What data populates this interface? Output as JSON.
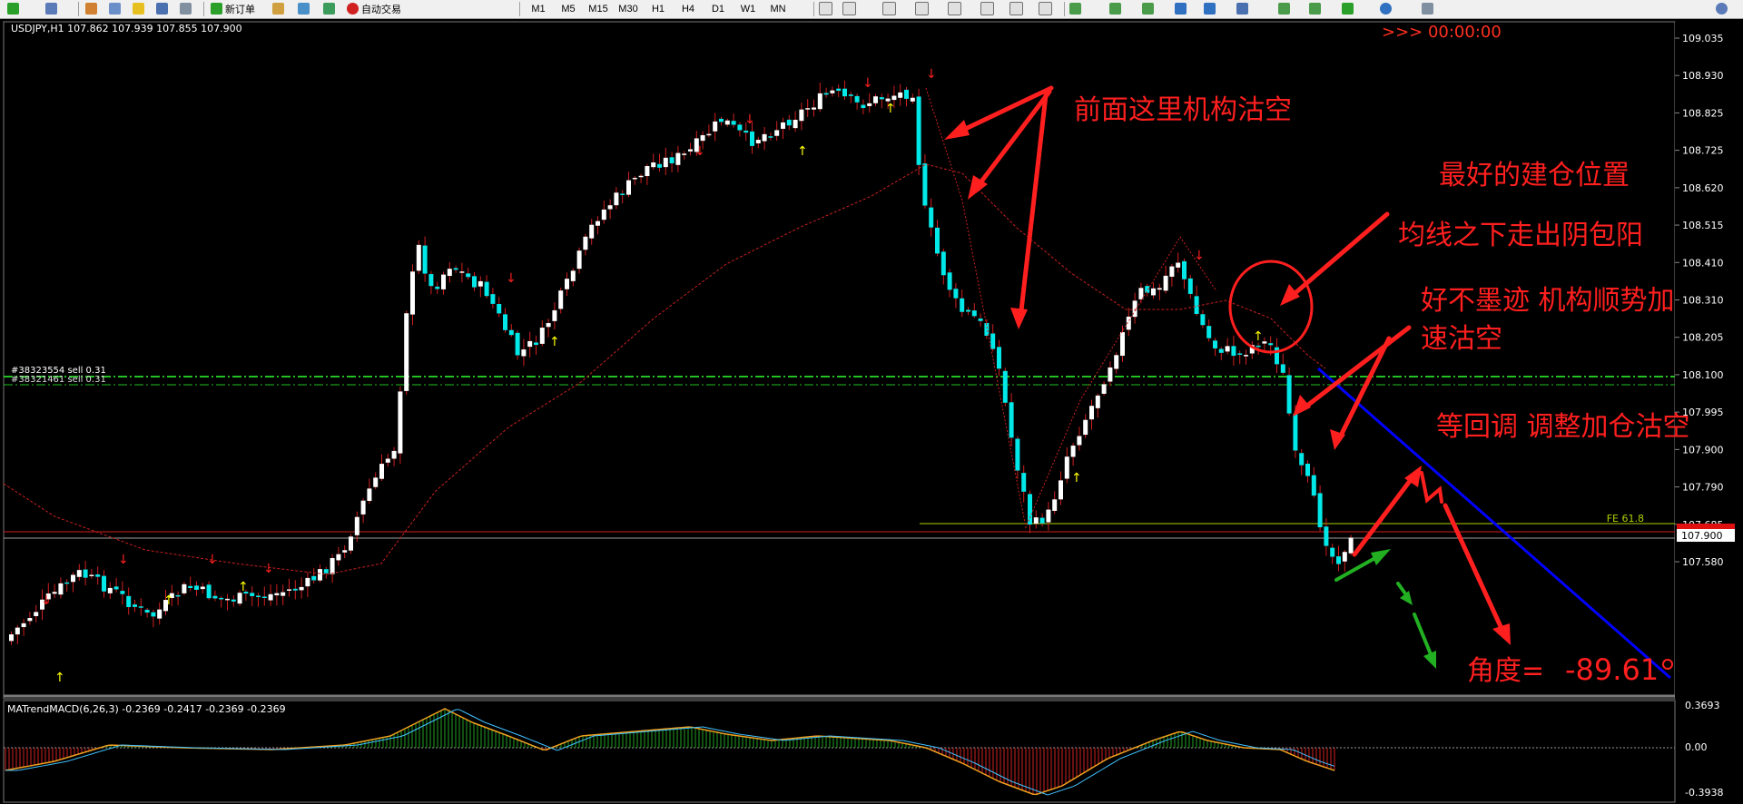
{
  "toolbar": {
    "new_order_label": "新订单",
    "auto_trading_label": "自动交易",
    "timeframes": [
      "M1",
      "M5",
      "M15",
      "M30",
      "H1",
      "H4",
      "D1",
      "W1",
      "MN"
    ]
  },
  "main": {
    "header": "USDJPY,H1  107.862 107.939 107.855 107.900",
    "countdown": ">>> 00:00:00",
    "order_line_1": "#38323554 sell 0.31",
    "order_line_2": "#38321461 sell 0.31",
    "fe_label": "FE 61.8",
    "price_tag": "107.900",
    "y_ticks": [
      "109.035",
      "108.930",
      "108.825",
      "108.725",
      "108.620",
      "108.515",
      "108.410",
      "108.310",
      "108.205",
      "108.100",
      "107.995",
      "107.900",
      "107.790",
      "107.685",
      "107.580"
    ]
  },
  "annotations": {
    "label_1": "前面这里机构沽空",
    "label_2": "最好的建仓位置",
    "label_3": "均线之下走出阴包阳",
    "label_4": "好不墨迹  机构顺势加",
    "label_5": "速沽空",
    "label_6": "等回调 调整加仓沽空",
    "angle_label": "角度=",
    "angle_value": "-89.61"
  },
  "indicator": {
    "header": "MATrendMACD(6,26,3) -0.2369 -0.2417 -0.2369 -0.2369",
    "y_ticks": [
      "0.3693",
      "0.00",
      "-0.3938"
    ]
  },
  "colors": {
    "bull_candle": "#ffffff",
    "bear_candle": "#00e8e8",
    "annotation_red": "#ff1f1f",
    "trend_line": "#0000ff",
    "order_lines": "#22c022",
    "fe_line": "#b0d000",
    "ma_line": "#c82020"
  }
}
